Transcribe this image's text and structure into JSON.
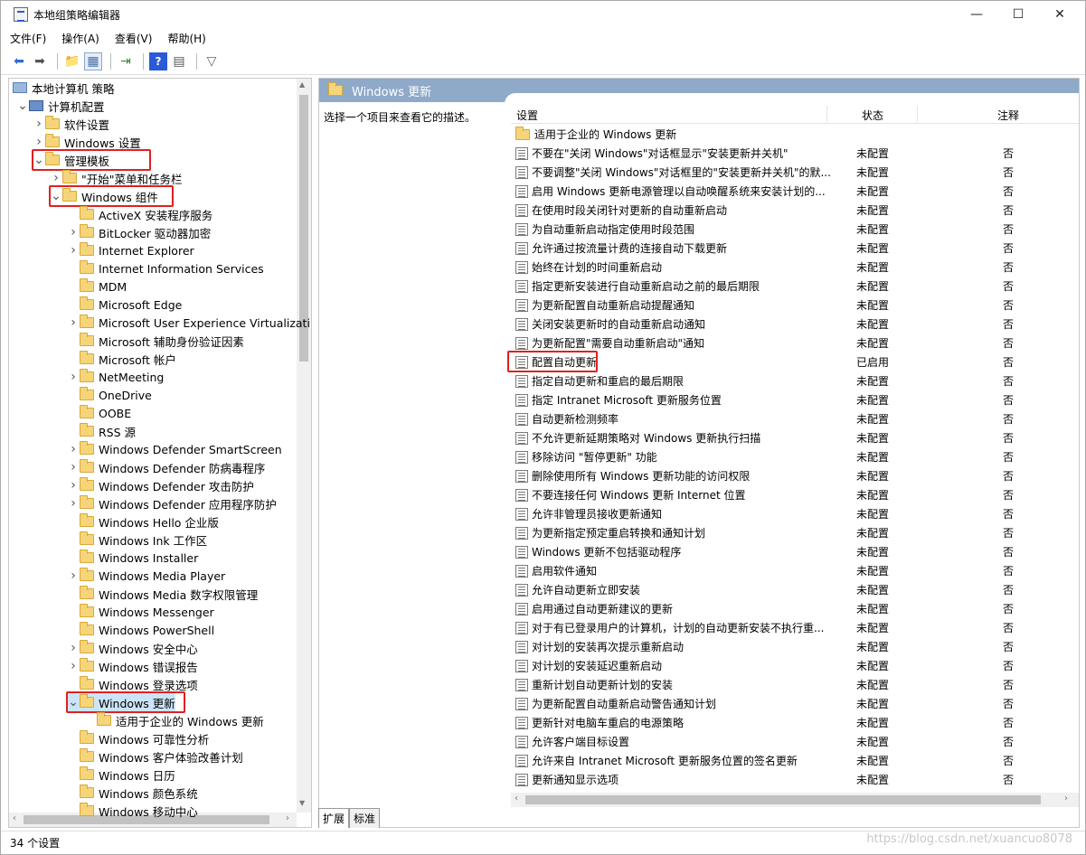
{
  "window": {
    "title": "本地组策略编辑器",
    "minimize": "—",
    "maximize": "☐",
    "close": "✕"
  },
  "menu": [
    "文件(F)",
    "操作(A)",
    "查看(V)",
    "帮助(H)"
  ],
  "tree": {
    "root": "本地计算机 策略",
    "items": [
      {
        "label": "计算机配置",
        "level": 1,
        "arrow": "▼",
        "icon": "pc"
      },
      {
        "label": "软件设置",
        "level": 2,
        "arrow": ">",
        "icon": "folder"
      },
      {
        "label": "Windows 设置",
        "level": 2,
        "arrow": ">",
        "icon": "folder"
      },
      {
        "label": "管理模板",
        "level": 2,
        "arrow": "▼",
        "icon": "folder",
        "highlight": true
      },
      {
        "label": "\"开始\"菜单和任务栏",
        "level": 3,
        "arrow": ">",
        "icon": "folder"
      },
      {
        "label": "Windows 组件",
        "level": 3,
        "arrow": "▼",
        "icon": "folder",
        "highlight": true
      },
      {
        "label": "ActiveX 安装程序服务",
        "level": 4,
        "arrow": "",
        "icon": "folder"
      },
      {
        "label": "BitLocker 驱动器加密",
        "level": 4,
        "arrow": ">",
        "icon": "folder"
      },
      {
        "label": "Internet Explorer",
        "level": 4,
        "arrow": ">",
        "icon": "folder"
      },
      {
        "label": "Internet Information Services",
        "level": 4,
        "arrow": "",
        "icon": "folder"
      },
      {
        "label": "MDM",
        "level": 4,
        "arrow": "",
        "icon": "folder"
      },
      {
        "label": "Microsoft Edge",
        "level": 4,
        "arrow": "",
        "icon": "folder"
      },
      {
        "label": "Microsoft User Experience Virtualizati",
        "level": 4,
        "arrow": ">",
        "icon": "folder"
      },
      {
        "label": "Microsoft 辅助身份验证因素",
        "level": 4,
        "arrow": "",
        "icon": "folder"
      },
      {
        "label": "Microsoft 帐户",
        "level": 4,
        "arrow": "",
        "icon": "folder"
      },
      {
        "label": "NetMeeting",
        "level": 4,
        "arrow": ">",
        "icon": "folder"
      },
      {
        "label": "OneDrive",
        "level": 4,
        "arrow": "",
        "icon": "folder"
      },
      {
        "label": "OOBE",
        "level": 4,
        "arrow": "",
        "icon": "folder"
      },
      {
        "label": "RSS 源",
        "level": 4,
        "arrow": "",
        "icon": "folder"
      },
      {
        "label": "Windows Defender SmartScreen",
        "level": 4,
        "arrow": ">",
        "icon": "folder"
      },
      {
        "label": "Windows Defender 防病毒程序",
        "level": 4,
        "arrow": ">",
        "icon": "folder"
      },
      {
        "label": "Windows Defender 攻击防护",
        "level": 4,
        "arrow": ">",
        "icon": "folder"
      },
      {
        "label": "Windows Defender 应用程序防护",
        "level": 4,
        "arrow": ">",
        "icon": "folder"
      },
      {
        "label": "Windows Hello 企业版",
        "level": 4,
        "arrow": "",
        "icon": "folder"
      },
      {
        "label": "Windows Ink 工作区",
        "level": 4,
        "arrow": "",
        "icon": "folder"
      },
      {
        "label": "Windows Installer",
        "level": 4,
        "arrow": "",
        "icon": "folder"
      },
      {
        "label": "Windows Media Player",
        "level": 4,
        "arrow": ">",
        "icon": "folder"
      },
      {
        "label": "Windows Media 数字权限管理",
        "level": 4,
        "arrow": "",
        "icon": "folder"
      },
      {
        "label": "Windows Messenger",
        "level": 4,
        "arrow": "",
        "icon": "folder"
      },
      {
        "label": "Windows PowerShell",
        "level": 4,
        "arrow": "",
        "icon": "folder"
      },
      {
        "label": "Windows 安全中心",
        "level": 4,
        "arrow": ">",
        "icon": "folder"
      },
      {
        "label": "Windows 错误报告",
        "level": 4,
        "arrow": ">",
        "icon": "folder"
      },
      {
        "label": "Windows 登录选项",
        "level": 4,
        "arrow": "",
        "icon": "folder"
      },
      {
        "label": "Windows 更新",
        "level": 4,
        "arrow": "▼",
        "icon": "folder",
        "highlight": true,
        "selected": true
      },
      {
        "label": "适用于企业的 Windows 更新",
        "level": 5,
        "arrow": "",
        "icon": "folder"
      },
      {
        "label": "Windows 可靠性分析",
        "level": 4,
        "arrow": "",
        "icon": "folder"
      },
      {
        "label": "Windows 客户体验改善计划",
        "level": 4,
        "arrow": "",
        "icon": "folder"
      },
      {
        "label": "Windows 日历",
        "level": 4,
        "arrow": "",
        "icon": "folder"
      },
      {
        "label": "Windows 颜色系统",
        "level": 4,
        "arrow": "",
        "icon": "folder"
      },
      {
        "label": "Windows 移动中心",
        "level": 4,
        "arrow": "",
        "icon": "folder"
      }
    ]
  },
  "right": {
    "header": "Windows 更新",
    "description": "选择一个项目来查看它的描述。",
    "columns": {
      "setting": "设置",
      "state": "状态",
      "note": "注释"
    },
    "folder_row": "适用于企业的 Windows 更新",
    "rows": [
      {
        "name": "不要在\"关闭 Windows\"对话框显示\"安装更新并关机\"",
        "state": "未配置",
        "note": "否"
      },
      {
        "name": "不要调整\"关闭 Windows\"对话框里的\"安装更新并关机\"的默...",
        "state": "未配置",
        "note": "否"
      },
      {
        "name": "启用 Windows 更新电源管理以自动唤醒系统来安装计划的...",
        "state": "未配置",
        "note": "否"
      },
      {
        "name": "在使用时段关闭针对更新的自动重新启动",
        "state": "未配置",
        "note": "否"
      },
      {
        "name": "为自动重新启动指定使用时段范围",
        "state": "未配置",
        "note": "否"
      },
      {
        "name": "允许通过按流量计费的连接自动下载更新",
        "state": "未配置",
        "note": "否"
      },
      {
        "name": "始终在计划的时间重新启动",
        "state": "未配置",
        "note": "否"
      },
      {
        "name": "指定更新安装进行自动重新启动之前的最后期限",
        "state": "未配置",
        "note": "否"
      },
      {
        "name": "为更新配置自动重新启动提醒通知",
        "state": "未配置",
        "note": "否"
      },
      {
        "name": "关闭安装更新时的自动重新启动通知",
        "state": "未配置",
        "note": "否"
      },
      {
        "name": "为更新配置\"需要自动重新启动\"通知",
        "state": "未配置",
        "note": "否"
      },
      {
        "name": "配置自动更新",
        "state": "已启用",
        "note": "否",
        "highlight": true
      },
      {
        "name": "指定自动更新和重启的最后期限",
        "state": "未配置",
        "note": "否"
      },
      {
        "name": "指定 Intranet Microsoft 更新服务位置",
        "state": "未配置",
        "note": "否"
      },
      {
        "name": "自动更新检测频率",
        "state": "未配置",
        "note": "否"
      },
      {
        "name": "不允许更新延期策略对 Windows 更新执行扫描",
        "state": "未配置",
        "note": "否"
      },
      {
        "name": "移除访问 \"暂停更新\" 功能",
        "state": "未配置",
        "note": "否"
      },
      {
        "name": "删除使用所有 Windows 更新功能的访问权限",
        "state": "未配置",
        "note": "否"
      },
      {
        "name": "不要连接任何 Windows 更新 Internet 位置",
        "state": "未配置",
        "note": "否"
      },
      {
        "name": "允许非管理员接收更新通知",
        "state": "未配置",
        "note": "否"
      },
      {
        "name": "为更新指定预定重启转换和通知计划",
        "state": "未配置",
        "note": "否"
      },
      {
        "name": "Windows 更新不包括驱动程序",
        "state": "未配置",
        "note": "否"
      },
      {
        "name": "启用软件通知",
        "state": "未配置",
        "note": "否"
      },
      {
        "name": "允许自动更新立即安装",
        "state": "未配置",
        "note": "否"
      },
      {
        "name": "启用通过自动更新建议的更新",
        "state": "未配置",
        "note": "否"
      },
      {
        "name": "对于有已登录用户的计算机，计划的自动更新安装不执行重...",
        "state": "未配置",
        "note": "否"
      },
      {
        "name": "对计划的安装再次提示重新启动",
        "state": "未配置",
        "note": "否"
      },
      {
        "name": "对计划的安装延迟重新启动",
        "state": "未配置",
        "note": "否"
      },
      {
        "name": "重新计划自动更新计划的安装",
        "state": "未配置",
        "note": "否"
      },
      {
        "name": "为更新配置自动重新启动警告通知计划",
        "state": "未配置",
        "note": "否"
      },
      {
        "name": "更新针对电脑车重启的电源策略",
        "state": "未配置",
        "note": "否"
      },
      {
        "name": "允许客户端目标设置",
        "state": "未配置",
        "note": "否"
      },
      {
        "name": "允许来自 Intranet Microsoft 更新服务位置的签名更新",
        "state": "未配置",
        "note": "否"
      },
      {
        "name": "更新通知显示选项",
        "state": "未配置",
        "note": "否"
      }
    ]
  },
  "tabs": [
    "扩展",
    "标准"
  ],
  "status": "34 个设置",
  "watermark": "https://blog.csdn.net/xuancuo8078"
}
